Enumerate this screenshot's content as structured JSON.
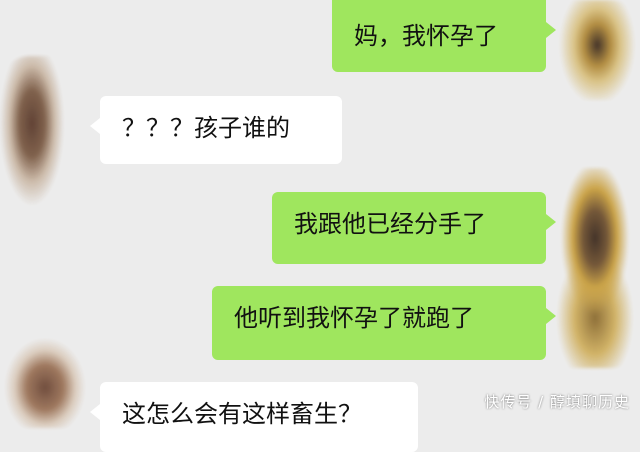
{
  "messages": [
    {
      "side": "out",
      "text": "妈，我怀孕了"
    },
    {
      "side": "in",
      "text": "？？？孩子谁的"
    },
    {
      "side": "out",
      "text": "我跟他已经分手了"
    },
    {
      "side": "out",
      "text": "他听到我怀孕了就跑了"
    },
    {
      "side": "in",
      "text": "这怎么会有这样畜生？"
    }
  ],
  "watermark": "快传号 / 醇填聊历史",
  "colors": {
    "background": "#ececec",
    "outgoing_bubble": "#9fe65e",
    "incoming_bubble": "#ffffff"
  }
}
